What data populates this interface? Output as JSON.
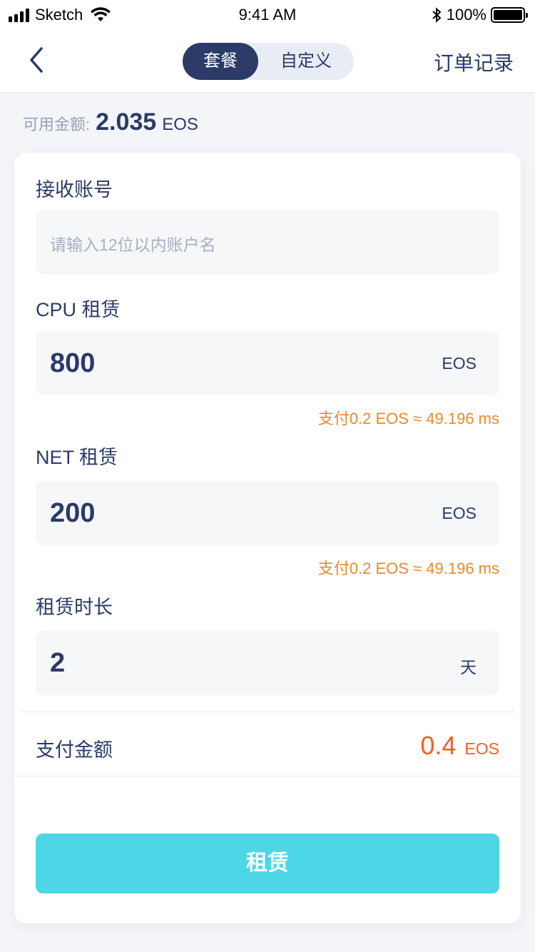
{
  "status_bar": {
    "carrier": "Sketch",
    "time": "9:41 AM",
    "battery": "100%"
  },
  "nav": {
    "tabs": [
      {
        "label": "套餐",
        "active": true
      },
      {
        "label": "自定义",
        "active": false
      }
    ],
    "order_link": "订单记录"
  },
  "balance": {
    "label": "可用金额:",
    "value": "2.035",
    "unit": "EOS"
  },
  "form": {
    "account": {
      "label": "接收账号",
      "placeholder": "请输入12位以内账户名"
    },
    "cpu": {
      "label": "CPU 租赁",
      "value": "800",
      "unit": "EOS",
      "hint": "支付0.2 EOS ≈ 49.196 ms"
    },
    "net": {
      "label": "NET 租赁",
      "value": "200",
      "unit": "EOS",
      "hint": "支付0.2 EOS ≈ 49.196 ms"
    },
    "duration": {
      "label": "租赁时长",
      "value": "2",
      "unit": "天"
    },
    "payment": {
      "label": "支付金额",
      "value": "0.4",
      "unit": "EOS"
    },
    "submit_label": "租赁"
  },
  "colors": {
    "primary": "#2b3a67",
    "accent": "#4dd7e6",
    "hint": "#f0872a",
    "amount": "#ff5a23"
  }
}
